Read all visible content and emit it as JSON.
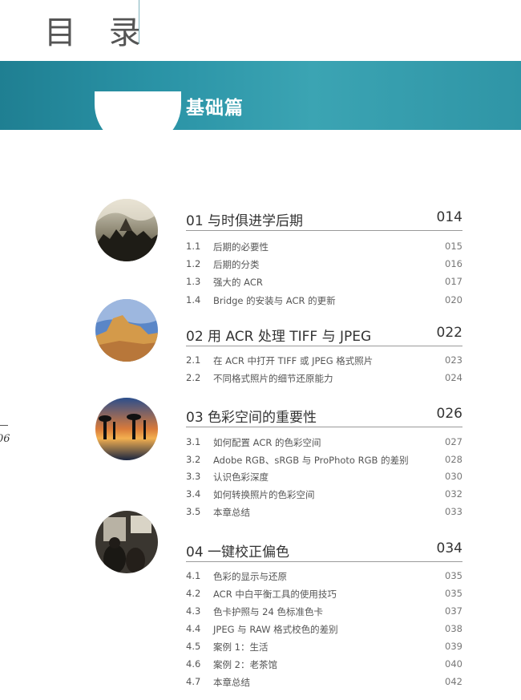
{
  "header": {
    "title": "目 录"
  },
  "banner": {
    "title": "基础篇"
  },
  "side": {
    "page_number": "06"
  },
  "chapters": [
    {
      "title": "01 与时俱进学后期",
      "page": "014",
      "items": [
        {
          "num": "1.1",
          "label": "后期的必要性",
          "page": "015"
        },
        {
          "num": "1.2",
          "label": "后期的分类",
          "page": "016"
        },
        {
          "num": "1.3",
          "label": "强大的 ACR",
          "page": "017"
        },
        {
          "num": "1.4",
          "label": "Bridge 的安装与 ACR 的更新",
          "page": "020"
        }
      ]
    },
    {
      "title": "02 用 ACR 处理 TIFF 与 JPEG",
      "page": "022",
      "items": [
        {
          "num": "2.1",
          "label": "在 ACR 中打开 TIFF 或 JPEG 格式照片",
          "page": "023"
        },
        {
          "num": "2.2",
          "label": "不同格式照片的细节还原能力",
          "page": "024"
        }
      ]
    },
    {
      "title": "03 色彩空间的重要性",
      "page": "026",
      "items": [
        {
          "num": "3.1",
          "label": "如何配置 ACR 的色彩空间",
          "page": "027"
        },
        {
          "num": "3.2",
          "label": "Adobe RGB、sRGB 与 ProPhoto RGB 的差别",
          "page": "028"
        },
        {
          "num": "3.3",
          "label": "认识色彩深度",
          "page": "030"
        },
        {
          "num": "3.4",
          "label": "如何转换照片的色彩空间",
          "page": "032"
        },
        {
          "num": "3.5",
          "label": "本章总结",
          "page": "033"
        }
      ]
    },
    {
      "title": "04 一键校正偏色",
      "page": "034",
      "items": [
        {
          "num": "4.1",
          "label": "色彩的显示与还原",
          "page": "035"
        },
        {
          "num": "4.2",
          "label": "ACR 中白平衡工具的使用技巧",
          "page": "035"
        },
        {
          "num": "4.3",
          "label": "色卡护照与 24 色标准色卡",
          "page": "037"
        },
        {
          "num": "4.4",
          "label": "JPEG 与 RAW 格式校色的差别",
          "page": "038"
        },
        {
          "num": "4.5",
          "label": "案例 1：生活",
          "page": "039"
        },
        {
          "num": "4.6",
          "label": "案例 2：老茶馆",
          "page": "040"
        },
        {
          "num": "4.7",
          "label": "本章总结",
          "page": "042"
        }
      ]
    }
  ]
}
